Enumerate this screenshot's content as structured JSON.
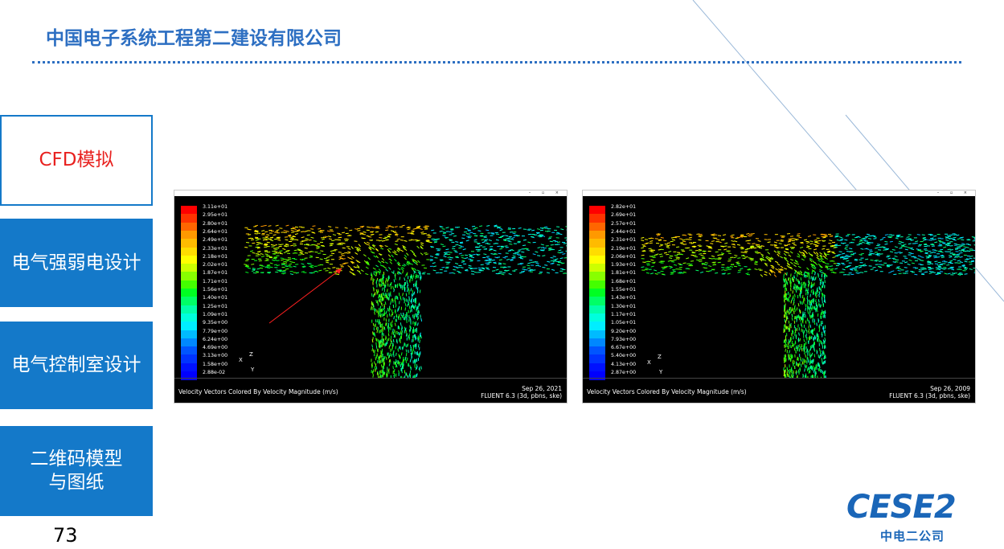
{
  "header": {
    "company_name": "中国电子系统工程第二建设有限公司"
  },
  "nav": {
    "items": [
      {
        "label": "CFD模拟",
        "active": true
      },
      {
        "label": "电气强弱电设计",
        "active": false
      },
      {
        "label": "电气控制室设计",
        "active": false
      },
      {
        "label": "二维码模型\n与图纸",
        "active": false
      }
    ]
  },
  "page_number": "73",
  "colors": {
    "accent_blue": "#1479c9",
    "title_blue": "#2d6fc2",
    "active_text_red": "#e8211f"
  },
  "simulations": [
    {
      "colorbar_labels": [
        "3.11e+01",
        "2.95e+01",
        "2.80e+01",
        "2.64e+01",
        "2.49e+01",
        "2.33e+01",
        "2.18e+01",
        "2.02e+01",
        "1.87e+01",
        "1.71e+01",
        "1.56e+01",
        "1.40e+01",
        "1.25e+01",
        "1.09e+01",
        "9.35e+00",
        "7.79e+00",
        "6.24e+00",
        "4.69e+00",
        "3.13e+00",
        "1.58e+00",
        "2.88e-02"
      ],
      "axis_x": "X",
      "axis_z": "Z",
      "axis_y": "Y",
      "caption": "Velocity Vectors Colored By Velocity Magnitude (m/s)",
      "date": "Sep 26, 2021",
      "solver": "FLUENT 6.3 (3d, pbns, ske)",
      "has_arrow_annotation": true
    },
    {
      "colorbar_labels": [
        "2.82e+01",
        "2.69e+01",
        "2.57e+01",
        "2.44e+01",
        "2.31e+01",
        "2.19e+01",
        "2.06e+01",
        "1.93e+01",
        "1.81e+01",
        "1.68e+01",
        "1.55e+01",
        "1.43e+01",
        "1.30e+01",
        "1.17e+01",
        "1.05e+01",
        "9.20e+00",
        "7.93e+00",
        "6.67e+00",
        "5.40e+00",
        "4.13e+00",
        "2.87e+00"
      ],
      "axis_x": "X",
      "axis_z": "Z",
      "axis_y": "Y",
      "caption": "Velocity Vectors Colored By Velocity Magnitude (m/s)",
      "date": "Sep 26, 2009",
      "solver": "FLUENT 6.3 (3d, pbns, ske)",
      "has_arrow_annotation": false
    }
  ],
  "colorbar_colors": [
    "#ff0000",
    "#ff3300",
    "#ff6600",
    "#ff9900",
    "#ffbb00",
    "#ffdd00",
    "#ffff00",
    "#ccff00",
    "#88ff00",
    "#44ff00",
    "#00ff22",
    "#00ff66",
    "#00ffaa",
    "#00ffdd",
    "#00eeff",
    "#00bbff",
    "#0088ff",
    "#0055ff",
    "#0033ff",
    "#0011ff",
    "#0000ff"
  ],
  "logo": {
    "mark": "CESE2",
    "sub": "中电二公司"
  }
}
